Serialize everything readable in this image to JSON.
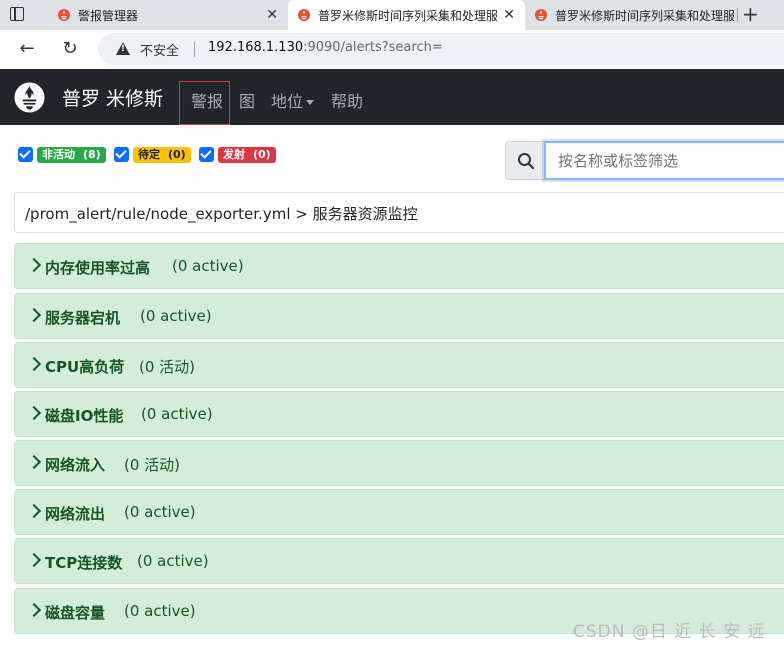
{
  "browser": {
    "tabs": [
      {
        "title": "警报管理器"
      },
      {
        "title": "普罗米修斯时间序列采集和处理服"
      },
      {
        "title": "普罗米修斯时间序列采集和处理服"
      }
    ],
    "new_tab_symbol": "+",
    "security_label": "不安全",
    "url_host": "192.168.1.130",
    "url_rest": ":9090/alerts?search="
  },
  "navbar": {
    "brand": "普罗 米修斯",
    "items": [
      {
        "label": "警报"
      },
      {
        "label": "图"
      },
      {
        "label": "地位"
      },
      {
        "label": "帮助"
      }
    ]
  },
  "filters": [
    {
      "label": "非活动",
      "count": "(8)",
      "color": "#28a745"
    },
    {
      "label": "待定",
      "count": "(0)",
      "color": "#ffc107"
    },
    {
      "label": "发射",
      "count": "(0)",
      "color": "#dc3545"
    }
  ],
  "search": {
    "placeholder": "按名称或标签筛选"
  },
  "rule_file": "/prom_alert/rule/node_exporter.yml > 服务器资源监控",
  "alerts": [
    {
      "name": "内存使用率过高",
      "state": "(0 active)"
    },
    {
      "name": "服务器宕机",
      "state": "(0 active)"
    },
    {
      "name": "CPU高负荷",
      "state": "(0 活动)"
    },
    {
      "name": "磁盘IO性能",
      "state": "(0 active)"
    },
    {
      "name": "网络流入",
      "state": "(0 活动)"
    },
    {
      "name": "网络流出",
      "state": "(0 active)"
    },
    {
      "name": "TCP连接数",
      "state": "(0 active)"
    },
    {
      "name": "磁盘容量",
      "state": "(0 active)"
    }
  ],
  "watermark": "CSDN @日 近 长 安 远",
  "colors": {
    "alert_bg": "#d4edda",
    "alert_text": "#155724",
    "navbar_bg": "#212529"
  }
}
